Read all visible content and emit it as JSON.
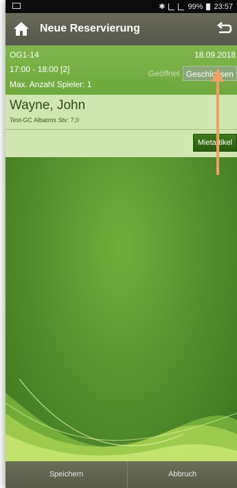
{
  "statusbar": {
    "battery": "99%",
    "time": "23:57"
  },
  "appbar": {
    "title": "Neue Reservierung"
  },
  "reservation": {
    "code": "OG1-14",
    "date": "18.09.2018",
    "time": "17:00 - 18:00 [2]",
    "max_players": "Max. Anzahl Spieler: 1",
    "toggle_open": "Geöffnet",
    "toggle_closed": "Geschlossen"
  },
  "player": {
    "name": "Wayne, John",
    "club": "Test-GC Albatros Stv: 7,0"
  },
  "actions": {
    "rental_label": "Mietartikel"
  },
  "bottombar": {
    "save_label": "Speichern",
    "cancel_label": "Abbruch"
  },
  "colors": {
    "accent_green": "#4f8a2a",
    "annotation_arrow": "#f0a060"
  }
}
